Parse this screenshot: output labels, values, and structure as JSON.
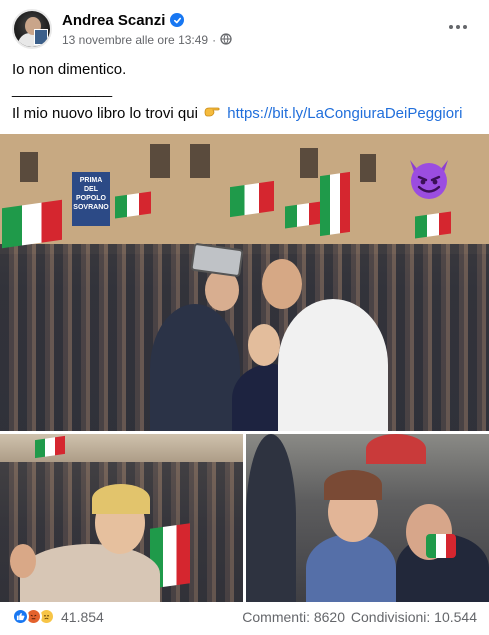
{
  "post": {
    "author": "Andrea Scanzi",
    "timestamp": "13 novembre alle ore 13:49",
    "icons": {
      "verified": "verified-badge-icon",
      "privacy": "globe-icon",
      "more": "more-options-icon",
      "pointer": "backhand-index-pointing-right-icon",
      "overlay": "smiling-face-with-horns-icon"
    },
    "text": {
      "line1": "Io non dimentico.",
      "line2": "____________",
      "line3_prefix": "Il mio nuovo libro lo trovi qui",
      "link": "https://bit.ly/LaCongiuraDeiPeggiori"
    },
    "photos": {
      "sign_text": "PRIMA DEL POPOLO SOVRANO"
    },
    "footer": {
      "reaction_icons": [
        "like-icon",
        "angry-icon",
        "sad-icon"
      ],
      "reaction_count": "41.854",
      "comments": "Commenti: 8620",
      "shares": "Condivisioni: 10.544"
    },
    "colors": {
      "link": "#216fdb",
      "secondary_text": "#65676b",
      "verified": "#1877f2",
      "like": "#1877f2"
    }
  }
}
